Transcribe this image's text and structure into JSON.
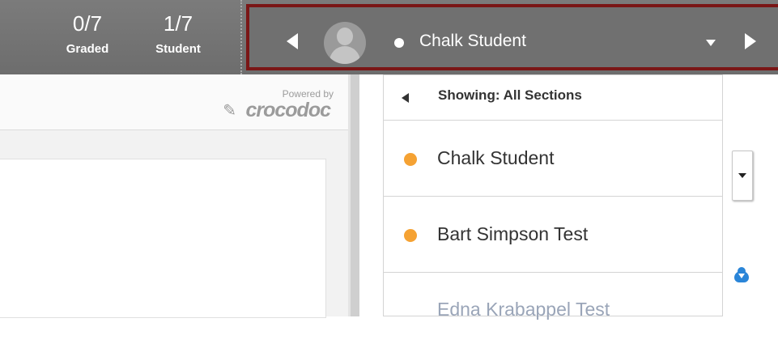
{
  "topbar": {
    "graded": {
      "value": "0/7",
      "label": "Graded"
    },
    "student": {
      "value": "1/7",
      "label": "Student"
    },
    "current_student": "Chalk Student",
    "status_color": "#ffffff",
    "frame_color": "#7a1616"
  },
  "viewer": {
    "powered_by": "Powered by",
    "brand": "crocodoc"
  },
  "student_dropdown": {
    "header": "Showing: All Sections",
    "students": [
      {
        "name": "Chalk Student",
        "status_color": "#f5a233"
      },
      {
        "name": "Bart Simpson Test",
        "status_color": "#f5a233"
      },
      {
        "name": "Edna Krabappel Test",
        "status_color": ""
      }
    ]
  },
  "icons": {
    "prev": "chevron-left-icon",
    "next": "chevron-right-icon",
    "avatar": "user-avatar-icon",
    "dropdown": "caret-down-icon",
    "download": "cloud-download-icon"
  }
}
